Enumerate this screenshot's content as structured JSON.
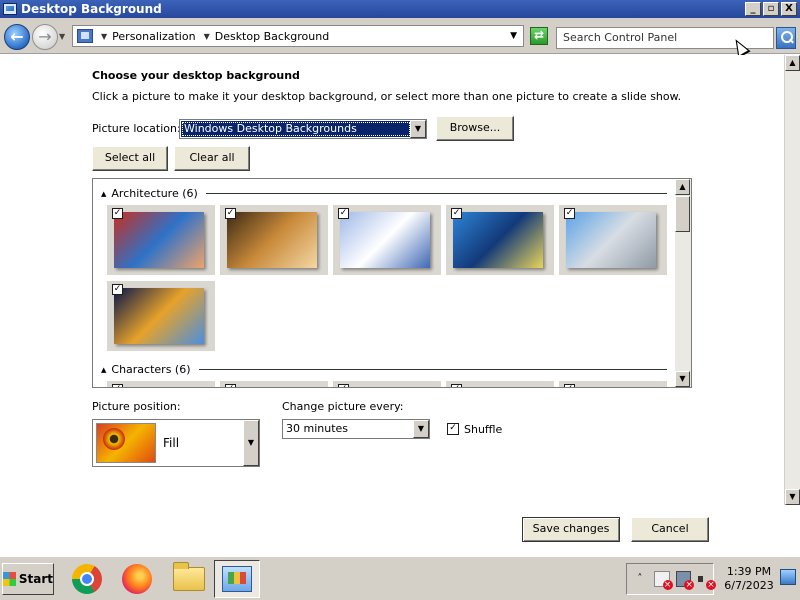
{
  "window": {
    "title": "Desktop Background",
    "buttons": {
      "minimize": "_",
      "maximize": "▫",
      "close": "X"
    }
  },
  "address": {
    "breadcrumbs": [
      "Personalization",
      "Desktop Background"
    ],
    "search_placeholder": "Search Control Panel"
  },
  "page": {
    "heading": "Choose your desktop background",
    "description": "Click a picture to make it your desktop background, or select more than one picture to create a slide show.",
    "picture_location_label": "Picture location:",
    "picture_location_value": "Windows Desktop Backgrounds",
    "browse_label": "Browse...",
    "select_all_label": "Select all",
    "clear_all_label": "Clear all"
  },
  "gallery": {
    "groups": [
      {
        "name": "Architecture (6)",
        "items": [
          {
            "checked": true,
            "colors": [
              "#c82e1f",
              "#2e72c8",
              "#f0a36a"
            ]
          },
          {
            "checked": true,
            "colors": [
              "#3c2a14",
              "#c98a3a",
              "#f3d7a5"
            ]
          },
          {
            "checked": true,
            "colors": [
              "#9fb8e8",
              "#ffffff",
              "#3f68b5"
            ]
          },
          {
            "checked": true,
            "colors": [
              "#2f84d6",
              "#123a7a",
              "#e9d45a"
            ]
          },
          {
            "checked": true,
            "colors": [
              "#5aa3e8",
              "#d8dde3",
              "#8f9aa6"
            ]
          },
          {
            "checked": true,
            "colors": [
              "#06154a",
              "#e6a22a",
              "#4a8fe0"
            ]
          }
        ]
      },
      {
        "name": "Characters (6)",
        "items": [
          {
            "checked": true,
            "colors": [
              "#2ea5df",
              "#bfeafc"
            ]
          },
          {
            "checked": true,
            "colors": [
              "#aed6c4",
              "#f0f6f2"
            ]
          },
          {
            "checked": true,
            "colors": [
              "#4a3a8f",
              "#e6e2f4"
            ]
          },
          {
            "checked": true,
            "colors": [
              "#c6dfe8",
              "#f8f8f8"
            ]
          },
          {
            "checked": true,
            "colors": [
              "#2aa3b6",
              "#0e5a76"
            ]
          }
        ]
      }
    ]
  },
  "position": {
    "label": "Picture position:",
    "value": "Fill"
  },
  "change": {
    "label": "Change picture every:",
    "value": "30 minutes",
    "shuffle_label": "Shuffle",
    "shuffle_checked": true
  },
  "actions": {
    "save_label": "Save changes",
    "cancel_label": "Cancel"
  },
  "taskbar": {
    "start_label": "Start",
    "apps": [
      "chrome-icon",
      "firefox-icon",
      "folder-icon",
      "control-panel-icon"
    ],
    "time": "1:39 PM",
    "date": "6/7/2023"
  }
}
